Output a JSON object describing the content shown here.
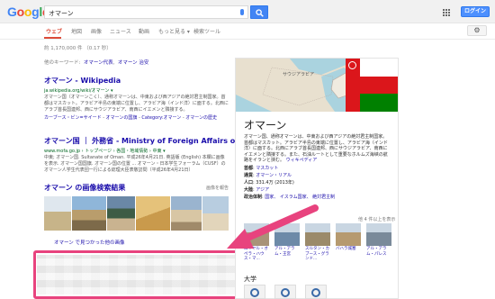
{
  "header": {
    "logo_letters": [
      {
        "ch": "G",
        "color": "#4285f4"
      },
      {
        "ch": "o",
        "color": "#ea4335"
      },
      {
        "ch": "o",
        "color": "#fbbc05"
      },
      {
        "ch": "g",
        "color": "#4285f4"
      },
      {
        "ch": "l",
        "color": "#34a853"
      },
      {
        "ch": "e",
        "color": "#ea4335"
      }
    ],
    "query": "オマーン",
    "login_label": "ログイン"
  },
  "tabs": [
    {
      "label": "ウェブ",
      "active": true
    },
    {
      "label": "地図"
    },
    {
      "label": "画像"
    },
    {
      "label": "ニュース"
    },
    {
      "label": "動画"
    },
    {
      "label": "もっと見る ▾"
    },
    {
      "label": "検索ツール"
    }
  ],
  "stats": "約 1,170,000 件 （0.17 秒）",
  "other_keywords": {
    "prefix": "他のキーワード:",
    "items": [
      "オマーン代表",
      "オマーン 治安"
    ]
  },
  "results": [
    {
      "title": "オマーン - Wikipedia",
      "url": "ja.wikipedia.org/wiki/オマーン ▾",
      "snippet": "オマーン国（オマーンこく）、通称オマーンは、中東および西アジアの絶対君主制国家。首都はマスカット。アラビア半島の東端に位置し、アラビア海（インド洋）に面する。北西にアラブ首長国連邦、西にサウジアラビア、南西にイエメンと隣接する。",
      "crumbs": [
        "カーブース・ビン=サイード",
        "オマーンの国旗",
        "Category:オマーン",
        "オマーンの歴史"
      ]
    },
    {
      "title": "オマーン国 ｜ 外務省 - Ministry of Foreign Affairs of Japan",
      "url": "www.mofa.go.jp › トップページ › 各国・地域情勢 › 中東 ▾",
      "snippet": "中東; オマーン国. Sultanate of Oman. 平成26年4月21日. 英語版 (English) 本欄に画像を表示. オマーン国国旗. オマーン国の位置 ... オマーン・日本学生フォーラム（CUSF）のオマーン人学生代表団一行による総理大臣表敬訪問（平成26年4月21日）"
    }
  ],
  "images_section": {
    "title": "オマーン の画像検索結果",
    "report": "画像を報告",
    "more_link": "オマーン で見つかった他の画像"
  },
  "knowledge_panel": {
    "map_labels": {
      "country": "サウジアラビア",
      "country2": "イエメン",
      "copyright": "地図データ ©2014 Google"
    },
    "title": "オマーン",
    "description": "オマーン国、通称オマーンは、中東および西アジアの絶対君主制国家。首都はマスカット。アラビア半島の東端に位置し、アラビア海（インド洋）に面する。北西にアラブ首長国連邦、西にサウジアラビア、南西にイエメンと隣接する。また、石油ルートとして重要なホルムズ海峡の航路をイランと挟む。",
    "wiki_link": "ウィキペディア",
    "facts": [
      {
        "key": "首都",
        "value": "マスカット"
      },
      {
        "key": "通貨",
        "value": "オマーン・リアル"
      },
      {
        "key": "人口",
        "value": "331.4万 (2013年)"
      },
      {
        "key": "大陸",
        "value": "アジア"
      },
      {
        "key": "政治体制",
        "value": "国家、 イスラム国家、 絶対君主制"
      }
    ],
    "more_label": "他 4 件以上を表示",
    "places": [
      {
        "label": "ロイヤル・オペラ・ハウス・マ...",
        "color": "#a89378"
      },
      {
        "label": "アル・アラム・王宮",
        "color": "#6d8aa8"
      },
      {
        "label": "スルタン・カブース・グランド...",
        "color": "#9b8a6a"
      },
      {
        "label": "バハラ城塞",
        "color": "#b69a70"
      },
      {
        "label": "アル・アラム・パレス",
        "color": "#7a8a9a"
      }
    ],
    "univ_title": "大学"
  },
  "colors": {
    "accent_red": "#dd4b39",
    "link_blue": "#1a0dab",
    "url_green": "#006621",
    "annotation_pink": "#e8437e"
  }
}
